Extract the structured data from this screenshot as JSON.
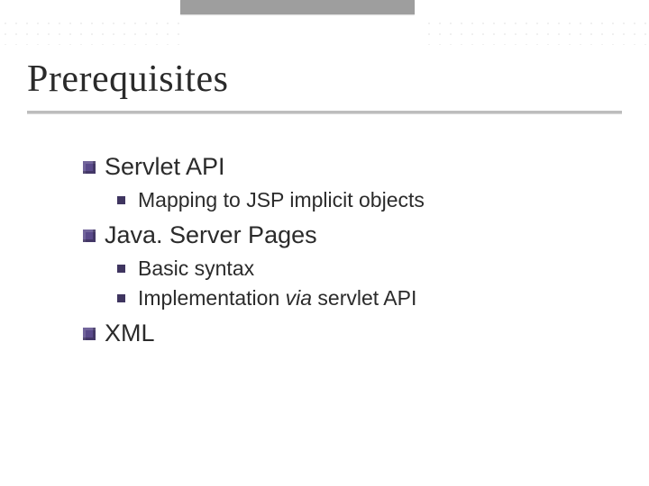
{
  "title": "Prerequisites",
  "items": {
    "servlet": {
      "label": "Servlet API",
      "sub": {
        "mapping": "Mapping to JSP implicit objects"
      }
    },
    "jsp": {
      "label": "Java. Server Pages",
      "sub": {
        "syntax": "Basic syntax",
        "impl_pre": "Implementation ",
        "impl_via": "via",
        "impl_post": " servlet API"
      }
    },
    "xml": {
      "label": "XML"
    }
  }
}
